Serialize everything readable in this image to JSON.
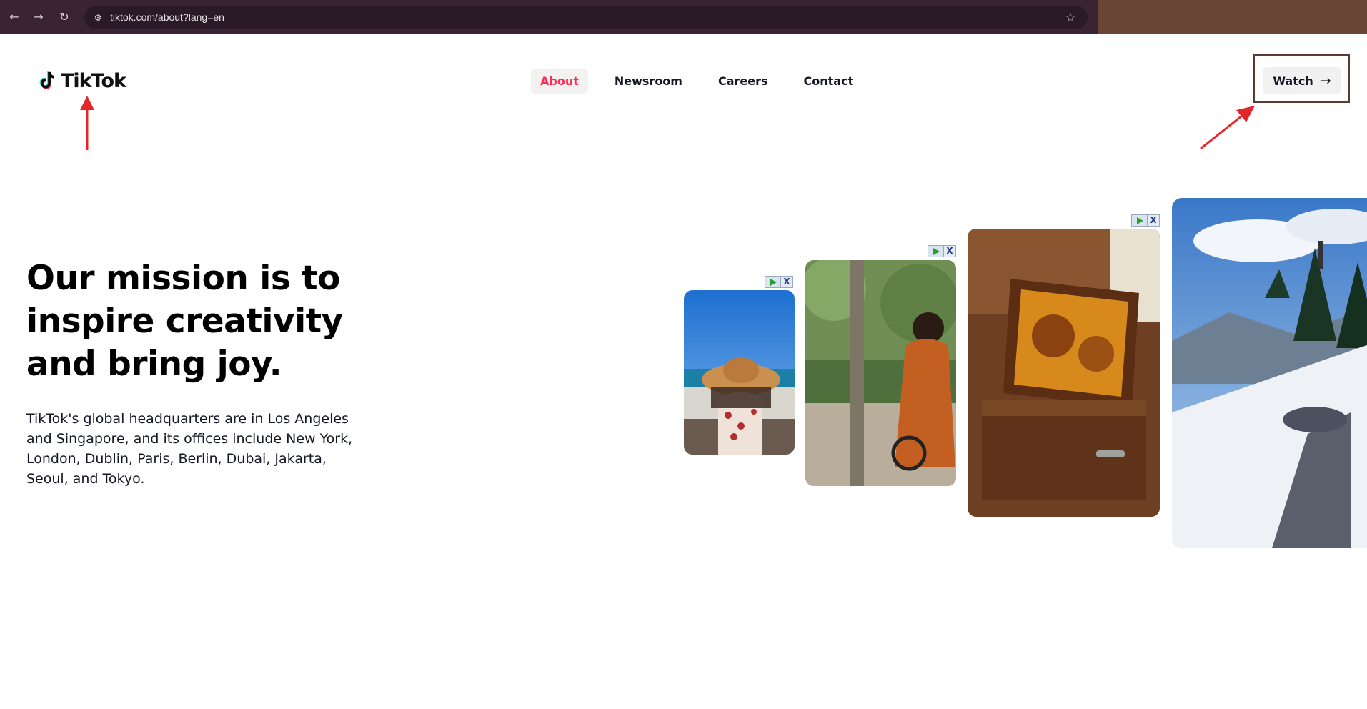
{
  "browser": {
    "back_icon": "←",
    "forward_icon": "→",
    "reload_icon": "↻",
    "site_settings_icon": "⚙",
    "url": "tiktok.com/about?lang=en",
    "star_icon": "☆"
  },
  "header": {
    "logo_text": "TikTok",
    "nav": [
      {
        "label": "About",
        "active": true
      },
      {
        "label": "Newsroom",
        "active": false
      },
      {
        "label": "Careers",
        "active": false
      },
      {
        "label": "Contact",
        "active": false
      }
    ],
    "watch_label": "Watch",
    "watch_icon": "→"
  },
  "hero": {
    "title": "Our mission is to inspire creativity and bring joy.",
    "body": "TikTok's global headquarters are in Los Angeles and Singapore, and its offices include New York, London, Dublin, Paris, Berlin, Dubai, Jakarta, Seoul, and Tokyo."
  },
  "gallery": {
    "ad_close": "X",
    "cards": [
      {
        "subject": "woman-in-sun-hat-by-sea"
      },
      {
        "subject": "woman-on-bicycle-in-forest"
      },
      {
        "subject": "beekeeper-with-honeycomb-frame"
      },
      {
        "subject": "snowy-mountain-ski-slope"
      }
    ]
  },
  "colors": {
    "accent": "#fe2c55",
    "text": "#161823",
    "annotation_red": "#e3262a",
    "annotation_frame": "#5a3a30"
  }
}
